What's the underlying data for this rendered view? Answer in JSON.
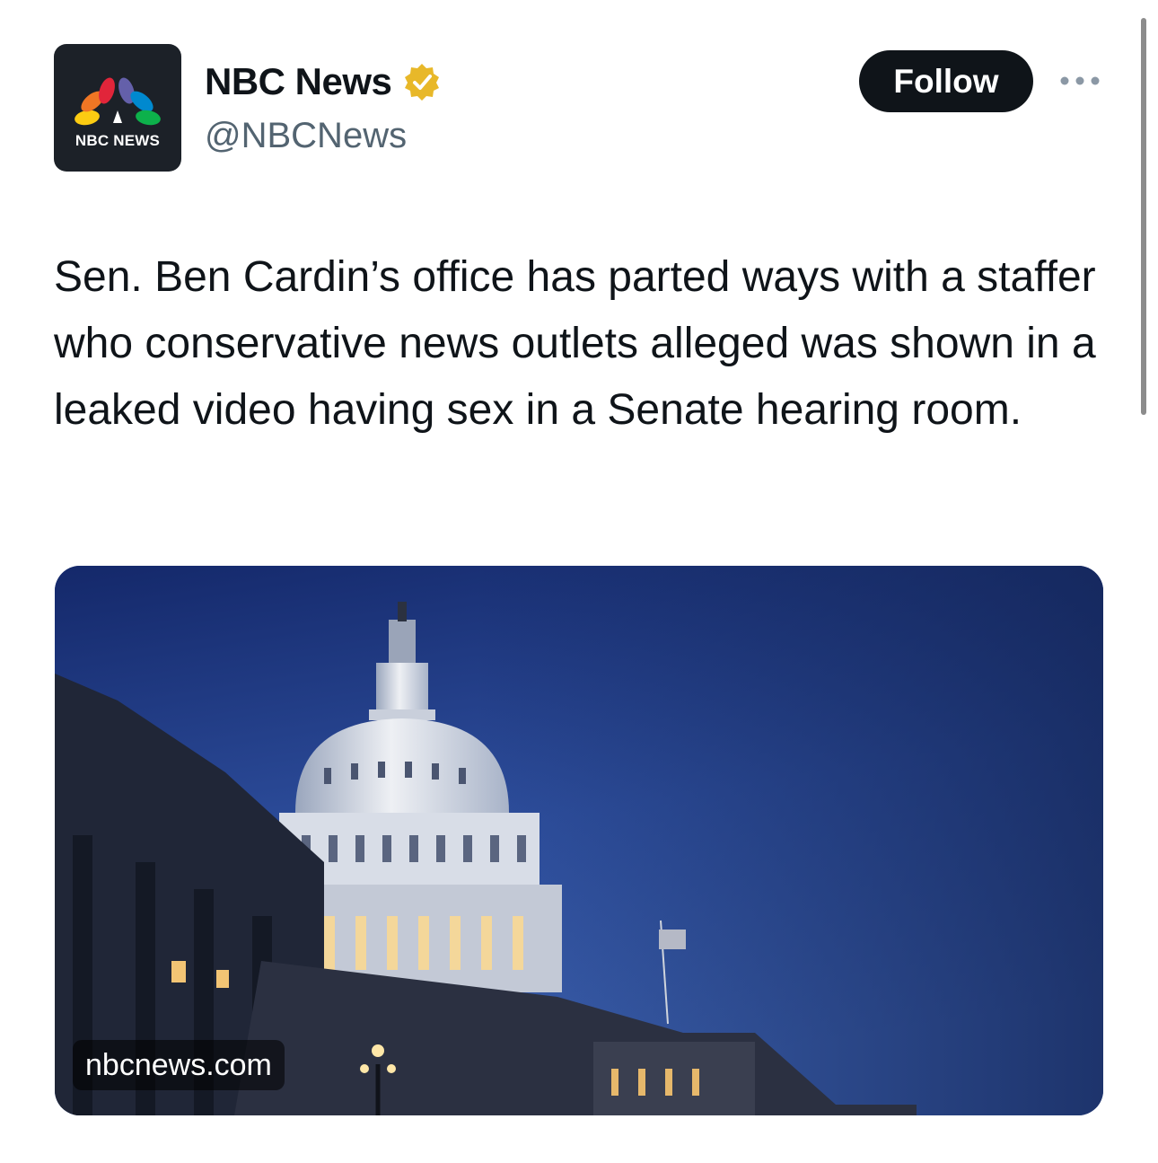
{
  "author": {
    "display_name": "NBC News",
    "handle": "@NBCNews",
    "avatar_label": "NBC NEWS",
    "verified": true,
    "badge_color": "#e8b829"
  },
  "actions": {
    "follow_label": "Follow",
    "more_icon": "more-horizontal-icon"
  },
  "tweet": {
    "text": "Sen. Ben Cardin’s office has parted ways with a staffer who conservative news outlets alleged was shown in a leaked video having sex in a Senate hearing room."
  },
  "link_card": {
    "domain": "nbcnews.com",
    "image_subject": "capitol-dome-photo"
  },
  "colors": {
    "text_primary": "#0f1419",
    "text_secondary": "#536471",
    "button_bg": "#0f1419"
  }
}
